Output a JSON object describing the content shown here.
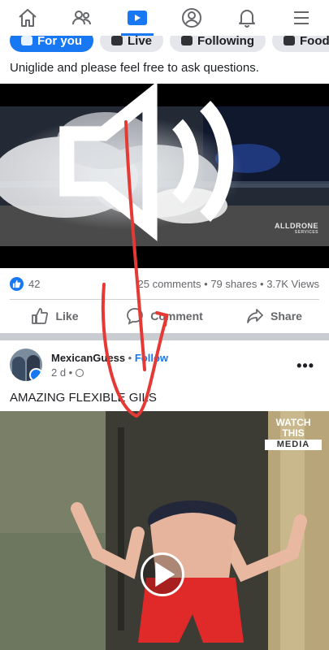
{
  "nav": {
    "items": [
      {
        "name": "home-icon"
      },
      {
        "name": "friends-icon"
      },
      {
        "name": "video-icon",
        "active": true
      },
      {
        "name": "profile-icon"
      },
      {
        "name": "notifications-icon"
      },
      {
        "name": "menu-icon"
      }
    ]
  },
  "chips": [
    "For you",
    "Live",
    "Following",
    "Food"
  ],
  "post1": {
    "caption": "Uniglide and please feel free to ask questions.",
    "watermark": "ALLDRONE",
    "watermark_sub": "SERVICES",
    "reactions": "42",
    "stats_right": "25 comments • 79 shares • 3.7K Views",
    "actions": {
      "like": "Like",
      "comment": "Comment",
      "share": "Share"
    }
  },
  "post2": {
    "author": "MexicanGuess",
    "follow_sep": "•",
    "follow": "Follow",
    "time": "2 d •",
    "caption": "AMAZING FLEXIBLE GILS",
    "watermark_top": "WATCH THIS",
    "watermark_bottom": "MEDIA"
  },
  "colors": {
    "accent": "#1877f2",
    "annotation": "#e53935"
  }
}
